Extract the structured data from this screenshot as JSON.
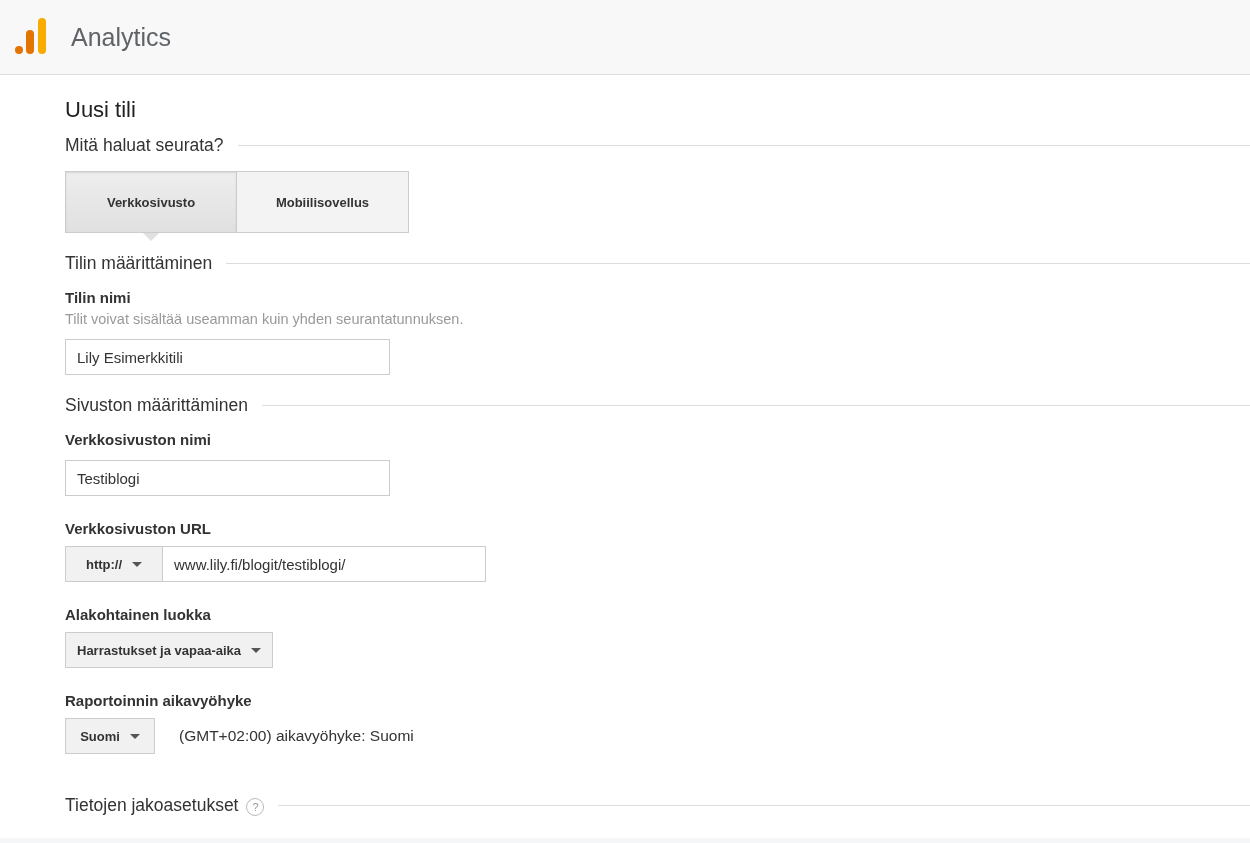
{
  "header": {
    "product": "Analytics"
  },
  "page_title": "Uusi tili",
  "track_section": {
    "heading": "Mitä haluat seurata?",
    "options": [
      {
        "label": "Verkkosivusto",
        "selected": true
      },
      {
        "label": "Mobiilisovellus",
        "selected": false
      }
    ]
  },
  "account_section": {
    "heading": "Tilin määrittäminen",
    "label": "Tilin nimi",
    "hint": "Tilit voivat sisältää useamman kuin yhden seurantatunnuksen.",
    "value": "Lily Esimerkkitili"
  },
  "site_section": {
    "heading": "Sivuston määrittäminen",
    "site_name": {
      "label": "Verkkosivuston nimi",
      "value": "Testiblogi"
    },
    "site_url": {
      "label": "Verkkosivuston URL",
      "protocol": "http://",
      "value": "www.lily.fi/blogit/testiblogi/"
    },
    "category": {
      "label": "Alakohtainen luokka",
      "value": "Harrastukset ja vapaa-aika"
    },
    "timezone": {
      "label": "Raportoinnin aikavyöhyke",
      "country": "Suomi",
      "description": "(GMT+02:00) aikavyöhyke: Suomi"
    }
  },
  "sharing_section": {
    "heading": "Tietojen jakoasetukset",
    "help": "?"
  }
}
